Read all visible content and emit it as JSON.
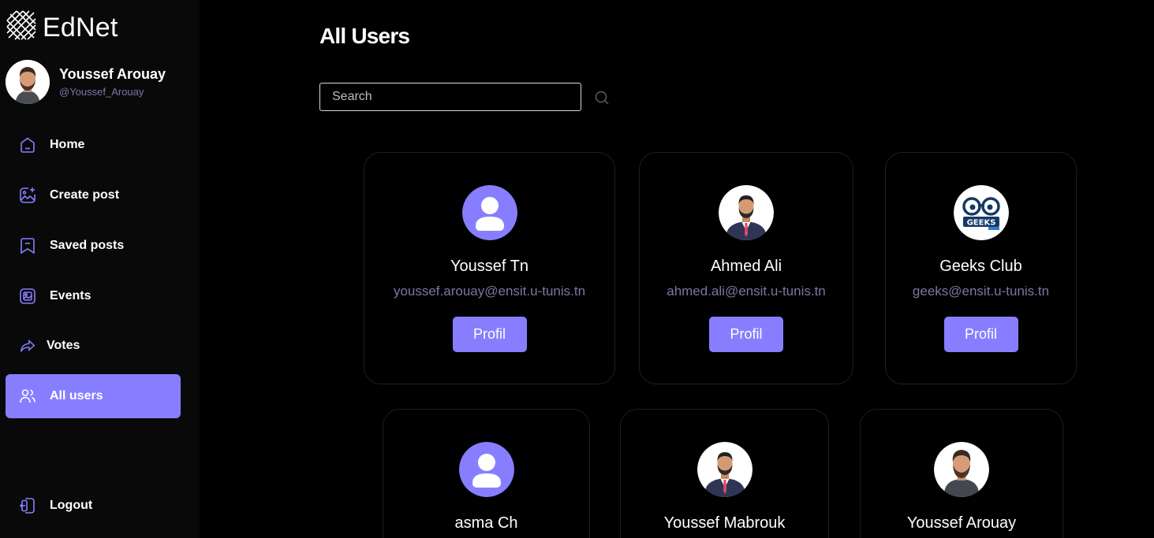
{
  "app": {
    "name": "EdNet"
  },
  "colors": {
    "accent": "#877eff",
    "muted": "#7878a3",
    "sidebar_bg": "#09090a",
    "page_bg": "#000000"
  },
  "current_user": {
    "name": "Youssef Arouay",
    "handle": "@Youssef_Arouay"
  },
  "sidebar": {
    "items": [
      {
        "label": "Home",
        "icon": "home-icon",
        "active": false
      },
      {
        "label": "Create post",
        "icon": "gallery-add-icon",
        "active": false
      },
      {
        "label": "Saved posts",
        "icon": "bookmark-icon",
        "active": false
      },
      {
        "label": "Events",
        "icon": "events-icon",
        "active": false
      },
      {
        "label": "Votes",
        "icon": "share-arrow-icon",
        "active": false
      },
      {
        "label": "All users",
        "icon": "people-icon",
        "active": true
      }
    ],
    "logout": {
      "label": "Logout",
      "icon": "logout-icon"
    }
  },
  "main": {
    "title": "All Users",
    "search": {
      "placeholder": "Search",
      "value": ""
    },
    "users": [
      {
        "name": "Youssef Tn",
        "email": "youssef.arouay@ensit.u-tunis.tn",
        "button": "Profil",
        "avatar": "default-avatar-icon"
      },
      {
        "name": "Ahmed Ali",
        "email": "ahmed.ali@ensit.u-tunis.tn",
        "button": "Profil",
        "avatar": "suited-man-avatar"
      },
      {
        "name": "Geeks Club",
        "email": "geeks@ensit.u-tunis.tn",
        "button": "Profil",
        "avatar": "geeks-logo"
      },
      {
        "name": "asma Ch",
        "avatar": "default-avatar-icon"
      },
      {
        "name": "Youssef Mabrouk",
        "avatar": "suited-man-avatar"
      },
      {
        "name": "Youssef Arouay",
        "avatar": "bearded-man-avatar"
      }
    ]
  }
}
